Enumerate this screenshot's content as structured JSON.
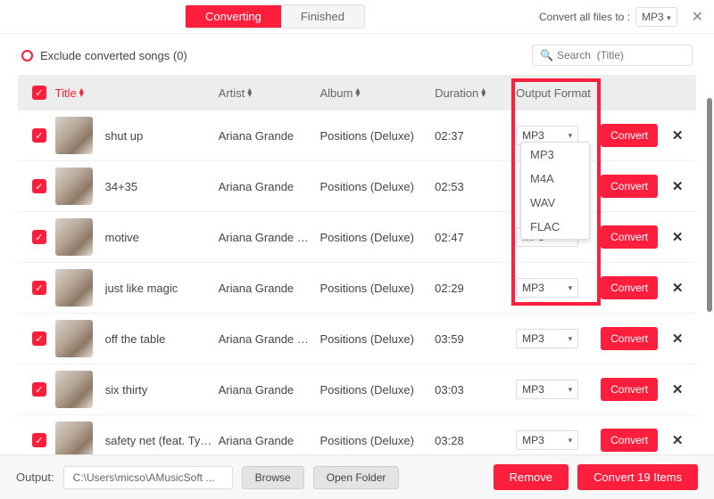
{
  "topbar": {
    "tabs": {
      "converting": "Converting",
      "finished": "Finished"
    },
    "convert_all_label": "Convert all files to :",
    "convert_all_value": "MP3"
  },
  "filter": {
    "exclude_label": "Exclude converted songs (0)",
    "search_placeholder": "Search  (Title)"
  },
  "headers": {
    "title": "Title",
    "artist": "Artist",
    "album": "Album",
    "duration": "Duration",
    "format": "Output Format"
  },
  "format_options": [
    "MP3",
    "M4A",
    "WAV",
    "FLAC"
  ],
  "convert_label": "Convert",
  "rows": [
    {
      "title": "shut up",
      "artist": "Ariana Grande",
      "album": "Positions (Deluxe)",
      "duration": "02:37",
      "format": "MP3"
    },
    {
      "title": "34+35",
      "artist": "Ariana Grande",
      "album": "Positions (Deluxe)",
      "duration": "02:53",
      "format": ""
    },
    {
      "title": "motive",
      "artist": "Ariana Grande & ...",
      "album": "Positions (Deluxe)",
      "duration": "02:47",
      "format": "MP3"
    },
    {
      "title": "just like magic",
      "artist": "Ariana Grande",
      "album": "Positions (Deluxe)",
      "duration": "02:29",
      "format": "MP3"
    },
    {
      "title": "off the table",
      "artist": "Ariana Grande & ...",
      "album": "Positions (Deluxe)",
      "duration": "03:59",
      "format": "MP3"
    },
    {
      "title": "six thirty",
      "artist": "Ariana Grande",
      "album": "Positions (Deluxe)",
      "duration": "03:03",
      "format": "MP3"
    },
    {
      "title": "safety net (feat. Ty ...",
      "artist": "Ariana Grande",
      "album": "Positions (Deluxe)",
      "duration": "03:28",
      "format": "MP3"
    }
  ],
  "bottom": {
    "output_label": "Output:",
    "output_path": "C:\\Users\\micso\\AMusicSoft ...",
    "browse": "Browse",
    "open_folder": "Open Folder",
    "remove": "Remove",
    "convert_n": "Convert 19 Items"
  }
}
